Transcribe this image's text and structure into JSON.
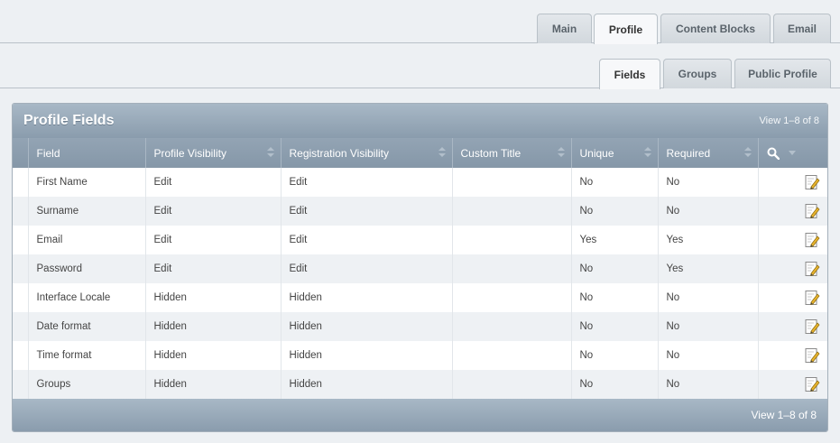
{
  "tabs": [
    {
      "label": "Main",
      "active": false
    },
    {
      "label": "Profile",
      "active": true
    },
    {
      "label": "Content Blocks",
      "active": false
    },
    {
      "label": "Email",
      "active": false
    }
  ],
  "subtabs": [
    {
      "label": "Fields",
      "active": true
    },
    {
      "label": "Groups",
      "active": false
    },
    {
      "label": "Public Profile",
      "active": false
    }
  ],
  "panel": {
    "title": "Profile Fields",
    "view_count_top": "View 1–8 of 8",
    "view_count_bottom": "View 1–8 of 8"
  },
  "table": {
    "columns": [
      "Field",
      "Profile Visibility",
      "Registration Visibility",
      "Custom Title",
      "Unique",
      "Required"
    ],
    "rows": [
      {
        "field": "First Name",
        "profile": "Edit",
        "registration": "Edit",
        "custom_title": "",
        "unique": "No",
        "required": "No"
      },
      {
        "field": "Surname",
        "profile": "Edit",
        "registration": "Edit",
        "custom_title": "",
        "unique": "No",
        "required": "No"
      },
      {
        "field": "Email",
        "profile": "Edit",
        "registration": "Edit",
        "custom_title": "",
        "unique": "Yes",
        "required": "Yes"
      },
      {
        "field": "Password",
        "profile": "Edit",
        "registration": "Edit",
        "custom_title": "",
        "unique": "No",
        "required": "Yes"
      },
      {
        "field": "Interface Locale",
        "profile": "Hidden",
        "registration": "Hidden",
        "custom_title": "",
        "unique": "No",
        "required": "No"
      },
      {
        "field": "Date format",
        "profile": "Hidden",
        "registration": "Hidden",
        "custom_title": "",
        "unique": "No",
        "required": "No"
      },
      {
        "field": "Time format",
        "profile": "Hidden",
        "registration": "Hidden",
        "custom_title": "",
        "unique": "No",
        "required": "No"
      },
      {
        "field": "Groups",
        "profile": "Hidden",
        "registration": "Hidden",
        "custom_title": "",
        "unique": "No",
        "required": "No"
      }
    ]
  },
  "icons": {
    "search": "search-icon",
    "edit": "edit-icon",
    "filter": "chevron-down-icon"
  }
}
